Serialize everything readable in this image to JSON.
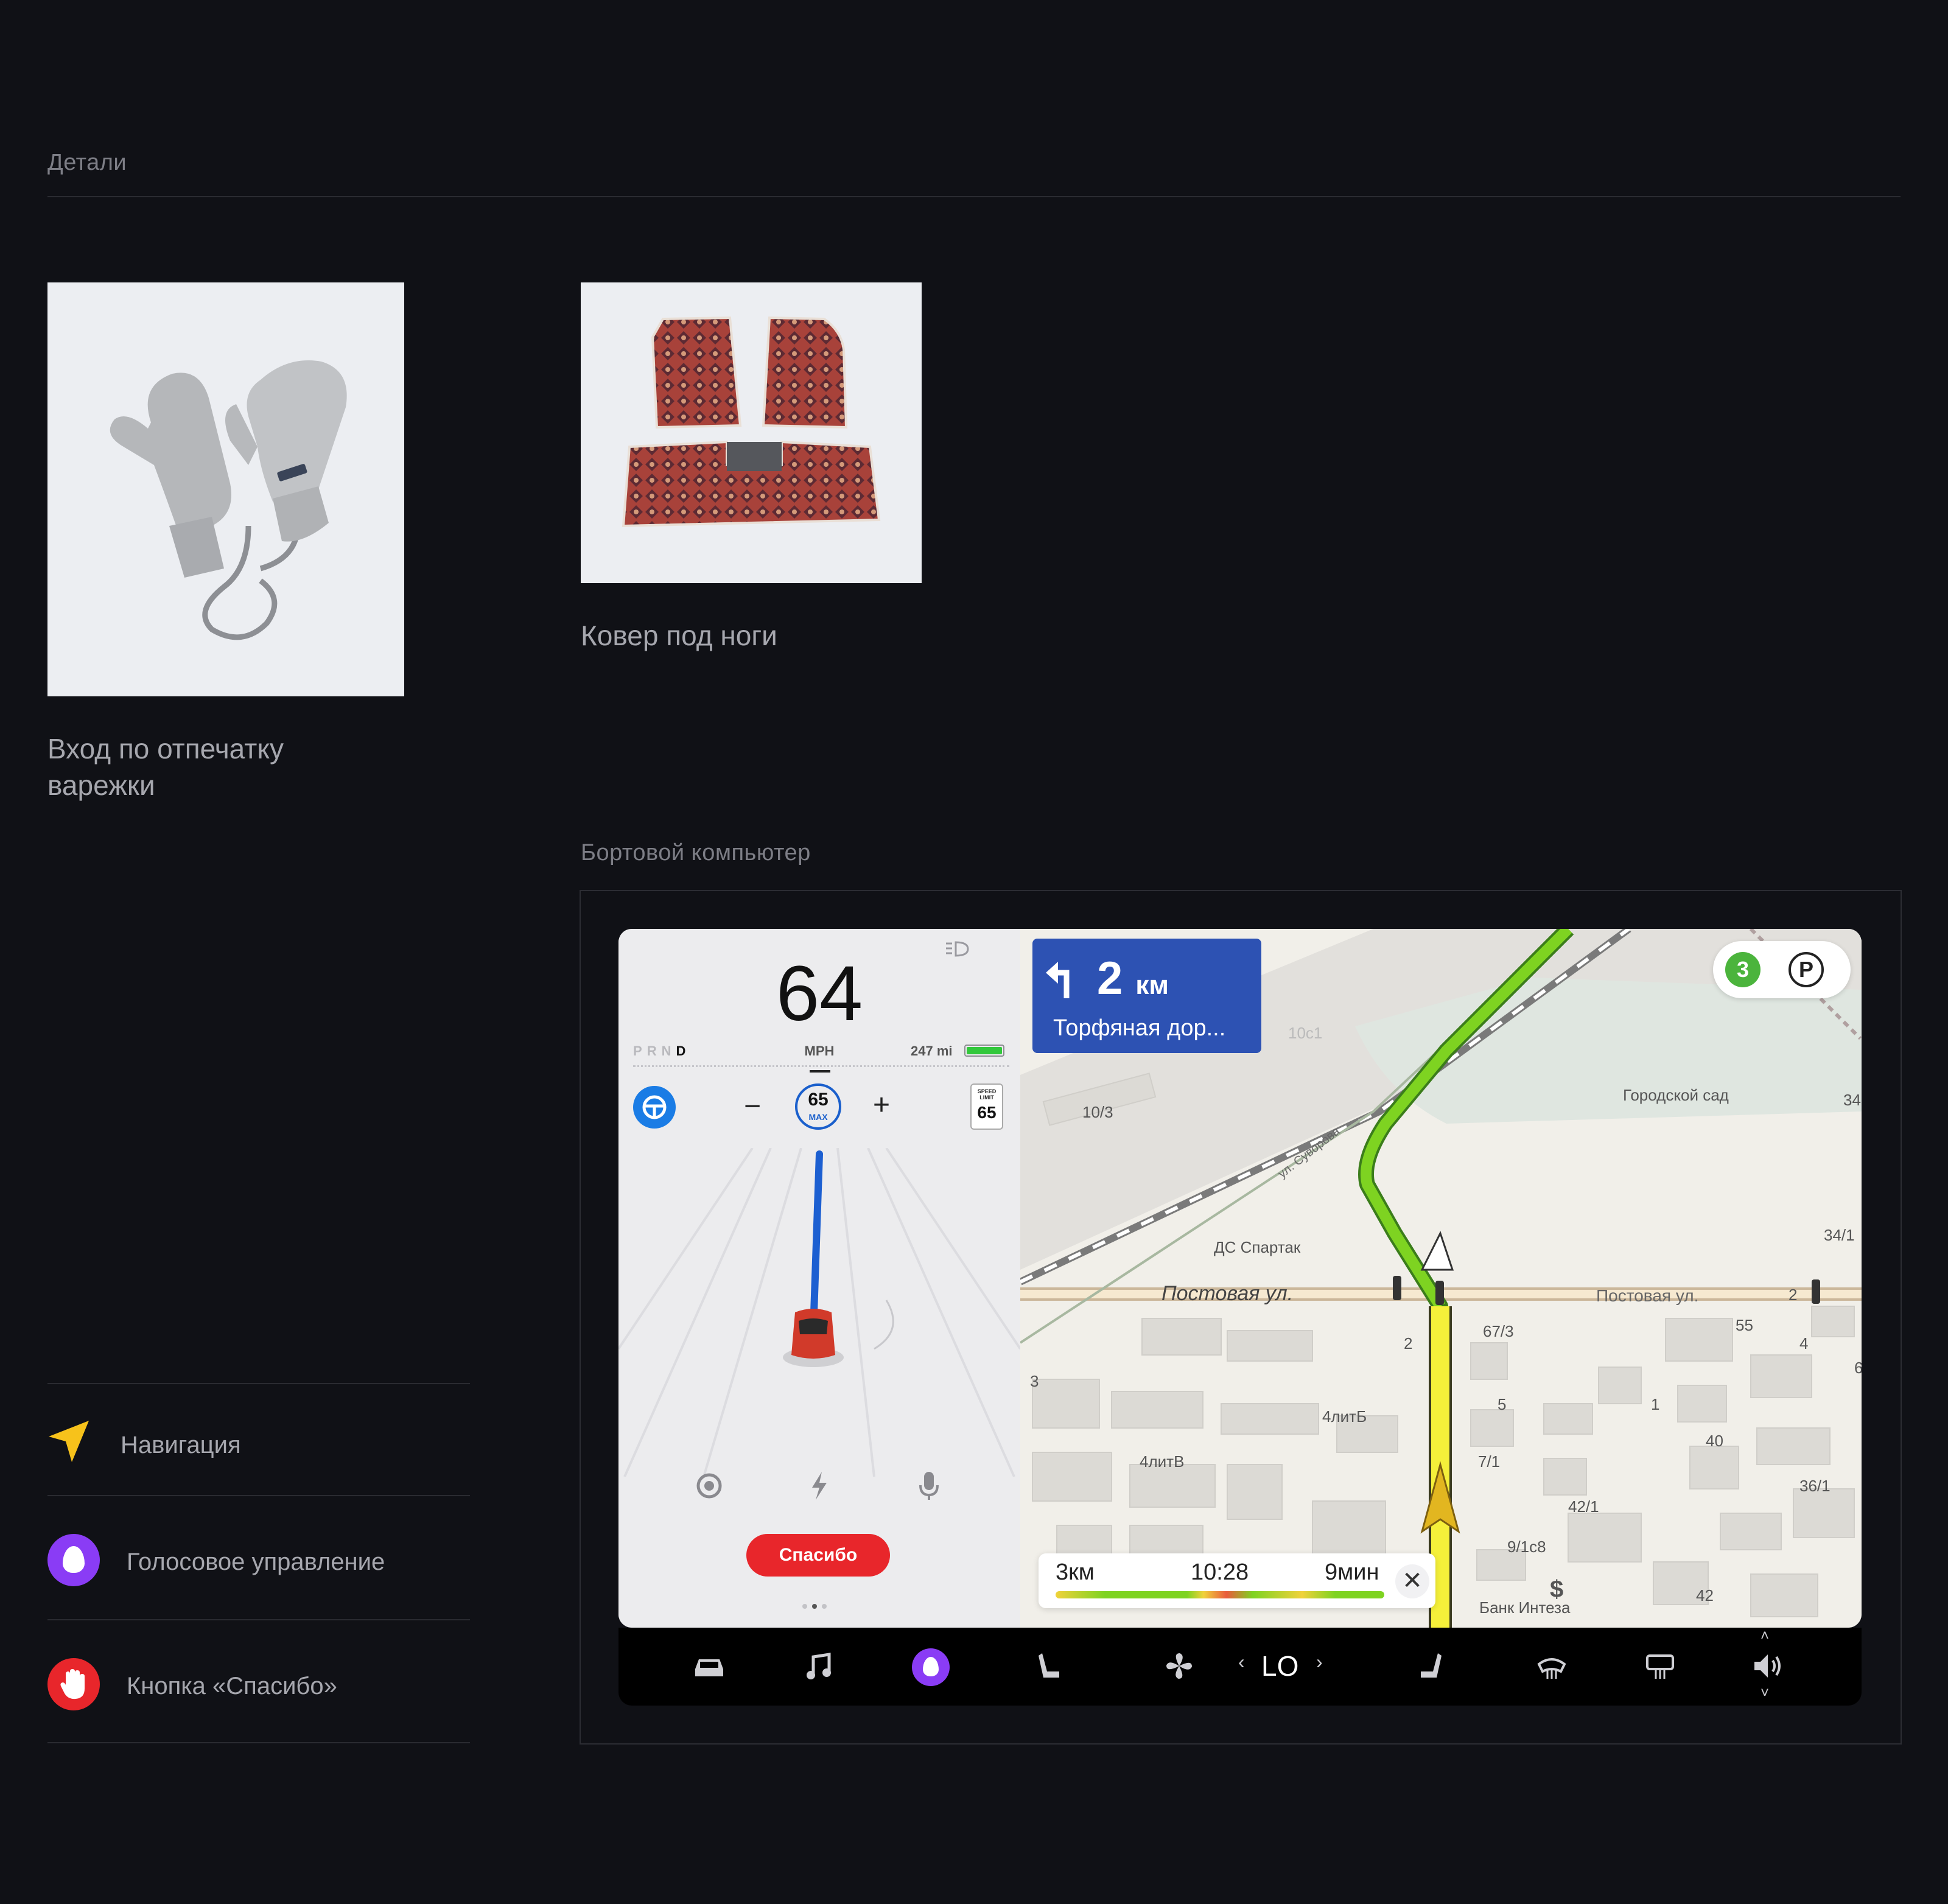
{
  "details": {
    "title": "Детали",
    "items": [
      {
        "caption": "Вход по отпечатку варежки"
      },
      {
        "caption": "Ковер под ноги"
      }
    ]
  },
  "features": [
    {
      "label": "Навигация",
      "icon": "navigation-arrow-icon",
      "color": "#f7c21b"
    },
    {
      "label": "Голосовое управление",
      "icon": "alice-voice-icon",
      "color": "#8a3cf5"
    },
    {
      "label": "Кнопка «Спасибо»",
      "icon": "hand-icon",
      "color": "#e8262b"
    }
  ],
  "onboard": {
    "title": "Бортовой компьютер",
    "cluster": {
      "speed": "64",
      "gears": [
        "P",
        "R",
        "N",
        "D"
      ],
      "active_gear": "D",
      "unit": "MPH",
      "range": "247 mi",
      "set_speed": "65",
      "set_speed_label": "MAX",
      "minus": "−",
      "plus": "+",
      "speed_limit_label": "SPEED LIMIT",
      "speed_limit": "65",
      "thanks_button": "Спасибо"
    },
    "navigation": {
      "maneuver_distance": "2",
      "maneuver_unit": "км",
      "maneuver_street": "Торфяная дор...",
      "traffic_score": "3",
      "parking": "P",
      "eta_distance": "3км",
      "eta_time": "10:28",
      "eta_duration": "9мин",
      "labels": {
        "park": "Городской сад",
        "stadium": "ДС Спартак",
        "street1": "Постовая ул.",
        "street2": "Постовая ул.",
        "street3": "ул. Суворова",
        "bank": "Банк Интеза",
        "h1": "10/3",
        "h2": "10с1",
        "h3": "34/1",
        "h4": "67/3",
        "h5": "55",
        "h6": "4",
        "h7": "2",
        "h8": "2",
        "h9": "3",
        "h10": "4литБ",
        "h11": "5",
        "h12": "1",
        "h13": "40",
        "h14": "4литВ",
        "h15": "7/1",
        "h16": "42/1",
        "h17": "36/1",
        "h18": "9/1с8",
        "h19": "42",
        "h20": "34",
        "h21": "6"
      }
    },
    "bottom_bar": {
      "climate_value": "LO",
      "icons": [
        "car-icon",
        "music-icon",
        "alice-icon",
        "seat-left-icon",
        "fan-icon",
        "seat-right-icon",
        "front-defrost-icon",
        "rear-defrost-icon",
        "volume-icon"
      ]
    }
  },
  "colors": {
    "background": "#101116",
    "accent_red": "#e8262b",
    "route_green": "#7ed321",
    "route_yellow": "#f5f03a",
    "nav_blue": "#2d52b3"
  }
}
